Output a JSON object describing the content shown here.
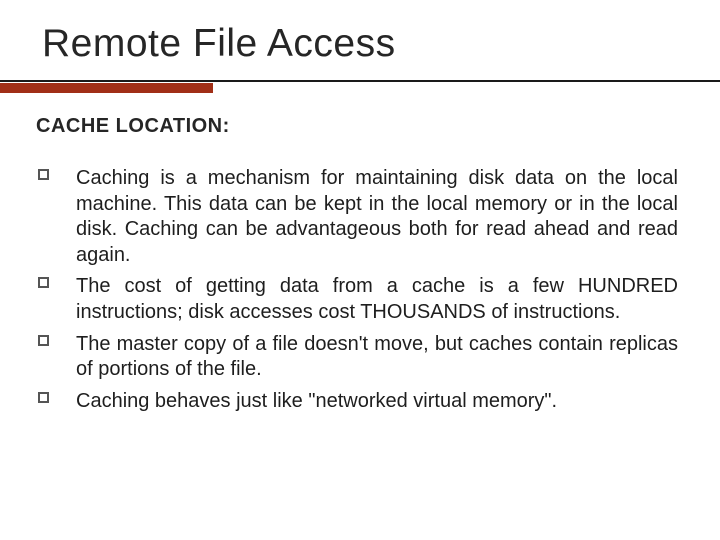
{
  "title": "Remote File Access",
  "subheading": "CACHE LOCATION:",
  "bullets": [
    "Caching is a mechanism for maintaining disk data on the local machine. This data can be kept in the local memory or in the local disk. Caching can be advantageous both for read ahead and read again.",
    "The cost of getting data from a cache is a few HUNDRED instructions; disk accesses cost THOUSANDS of instructions.",
    "The master copy of a file doesn't move, but caches contain replicas of portions of the file.",
    "Caching behaves just like \"networked virtual memory\"."
  ]
}
